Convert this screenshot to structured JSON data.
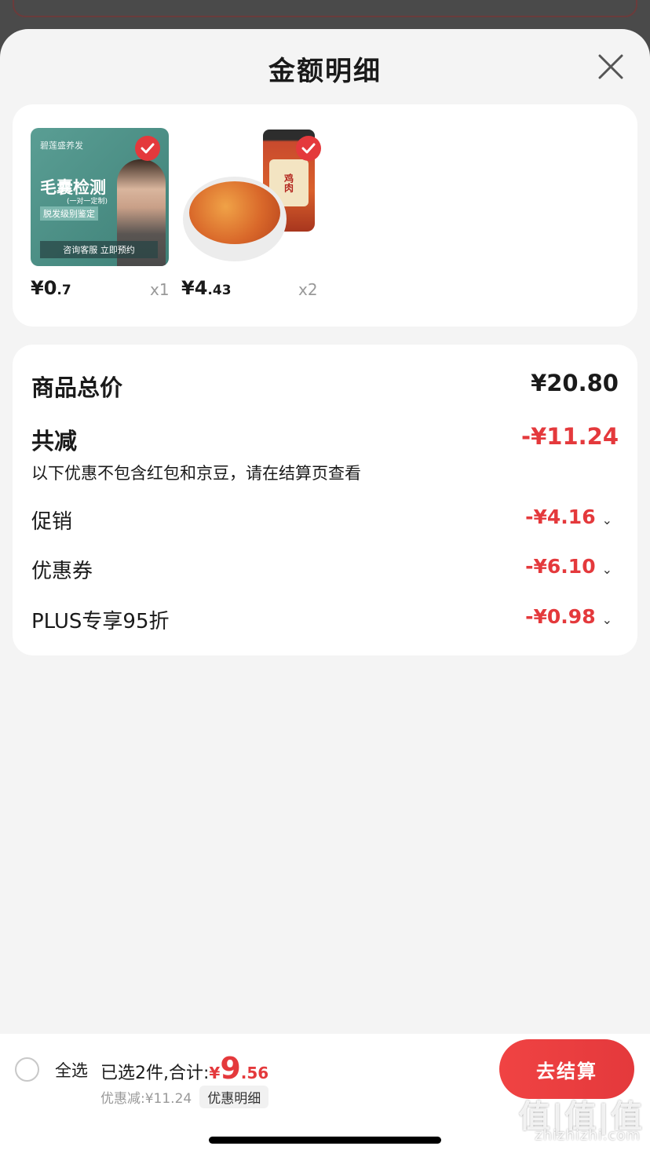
{
  "sheet": {
    "title": "金额明细",
    "close_icon": "close-icon"
  },
  "products": [
    {
      "image_text_brand": "碧莲盛养发",
      "image_text_title": "毛囊检测",
      "image_text_sub": "(一对一定制)",
      "image_text_tag": "脱发级别鉴定",
      "image_text_cta": "咨询客服 立即预约",
      "price_symbol": "¥",
      "price_int": "0",
      "price_dec": ".7",
      "qty": "x1",
      "checked": true
    },
    {
      "image_text_label": "鸡肉",
      "price_symbol": "¥",
      "price_int": "4",
      "price_dec": ".43",
      "qty": "x2",
      "checked": true
    }
  ],
  "summary": {
    "total_label": "商品总价",
    "total_value": "¥20.80",
    "reduce_label": "共减",
    "reduce_value": "-¥11.24",
    "hint": "以下优惠不包含红包和京豆，请在结算页查看",
    "items": [
      {
        "label": "促销",
        "value": "-¥4.16"
      },
      {
        "label": "优惠券",
        "value": "-¥6.10"
      },
      {
        "label": "PLUS专享95折",
        "value": "-¥0.98"
      }
    ]
  },
  "bottom": {
    "select_all": "全选",
    "selected_text": "已选2件,合计:",
    "total_symbol": "¥",
    "total_int": "9",
    "total_dec": ".56",
    "discount_text": "优惠减:¥11.24",
    "detail_label": "优惠明细",
    "checkout_label": "去结算"
  },
  "watermark": {
    "main": "值|值|值",
    "sub": "zhizhizhi.com"
  },
  "colors": {
    "accent": "#e4393c",
    "background": "#f4f4f4"
  }
}
